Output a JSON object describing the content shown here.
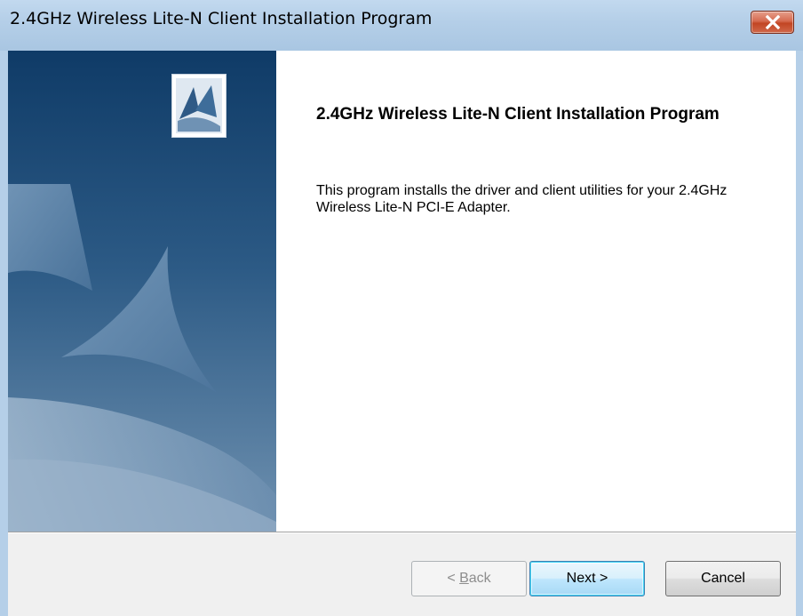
{
  "window": {
    "title": "2.4GHz Wireless Lite-N Client Installation Program",
    "close_icon": "close-x-icon",
    "accent_color": "#c24523"
  },
  "main": {
    "heading": "2.4GHz Wireless Lite-N Client Installation Program",
    "description": "This program installs the driver and client utilities for your 2.4GHz Wireless Lite-N PCI-E Adapter."
  },
  "side_panel": {
    "logo_icon": "setup-logo-icon",
    "artwork": "sails-banner-image"
  },
  "buttons": {
    "back_prefix": "< ",
    "back_mnemonic": "B",
    "back_rest": "ack",
    "back_enabled": false,
    "next_label": "Next >",
    "cancel_label": "Cancel"
  }
}
